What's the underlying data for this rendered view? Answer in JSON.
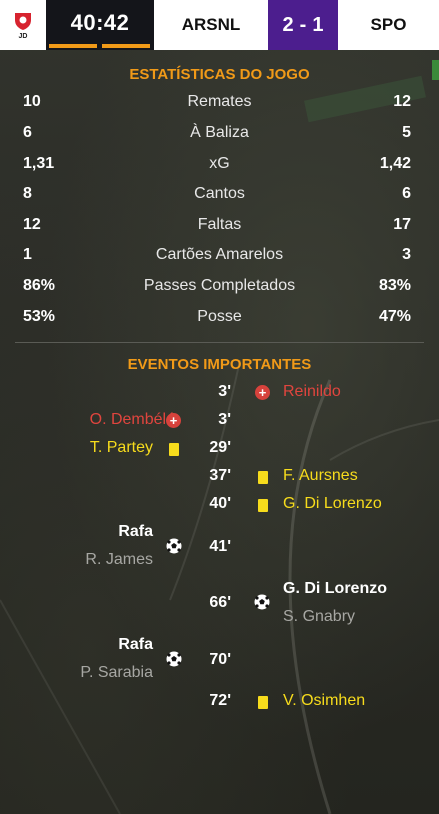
{
  "header": {
    "clock": "40:42",
    "home_team": "ARSNL",
    "home_score": "2",
    "score_separator": "-",
    "away_score": "1",
    "away_team": "SPO",
    "logo_text": "JD"
  },
  "stats": {
    "title": "ESTATÍSTICAS DO JOGO",
    "rows": [
      {
        "home": "10",
        "label": "Remates",
        "away": "12"
      },
      {
        "home": "6",
        "label": "À Baliza",
        "away": "5"
      },
      {
        "home": "1,31",
        "label": "xG",
        "away": "1,42"
      },
      {
        "home": "8",
        "label": "Cantos",
        "away": "6"
      },
      {
        "home": "12",
        "label": "Faltas",
        "away": "17"
      },
      {
        "home": "1",
        "label": "Cartões Amarelos",
        "away": "3"
      },
      {
        "home": "86%",
        "label": "Passes Completados",
        "away": "83%"
      },
      {
        "home": "53%",
        "label": "Posse",
        "away": "47%"
      }
    ]
  },
  "events": {
    "title": "EVENTOS IMPORTANTES",
    "items": [
      {
        "minute": "3'",
        "side": "away",
        "type": "injury",
        "player": "Reinildo"
      },
      {
        "minute": "3'",
        "side": "home",
        "type": "injury",
        "player": "O. Dembélé"
      },
      {
        "minute": "29'",
        "side": "home",
        "type": "yellow-card",
        "player": "T. Partey"
      },
      {
        "minute": "37'",
        "side": "away",
        "type": "yellow-card",
        "player": "F. Aursnes"
      },
      {
        "minute": "40'",
        "side": "away",
        "type": "yellow-card",
        "player": "G. Di Lorenzo"
      },
      {
        "minute": "41'",
        "side": "home",
        "type": "goal",
        "player": "Rafa",
        "assist": "R. James"
      },
      {
        "minute": "66'",
        "side": "away",
        "type": "goal",
        "player": "G. Di Lorenzo",
        "assist": "S. Gnabry"
      },
      {
        "minute": "70'",
        "side": "home",
        "type": "goal",
        "player": "Rafa",
        "assist": "P. Sarabia"
      },
      {
        "minute": "72'",
        "side": "away",
        "type": "yellow-card",
        "player": "V. Osimhen"
      }
    ]
  },
  "colors": {
    "accent": "#f19a18",
    "score_bg": "#4c1e8e",
    "yellow_card": "#f7dc1c",
    "injury": "#d7423c"
  },
  "icons": {
    "injury": "red-cross-icon",
    "yellow_card": "yellow-card-icon",
    "goal": "football-icon"
  }
}
